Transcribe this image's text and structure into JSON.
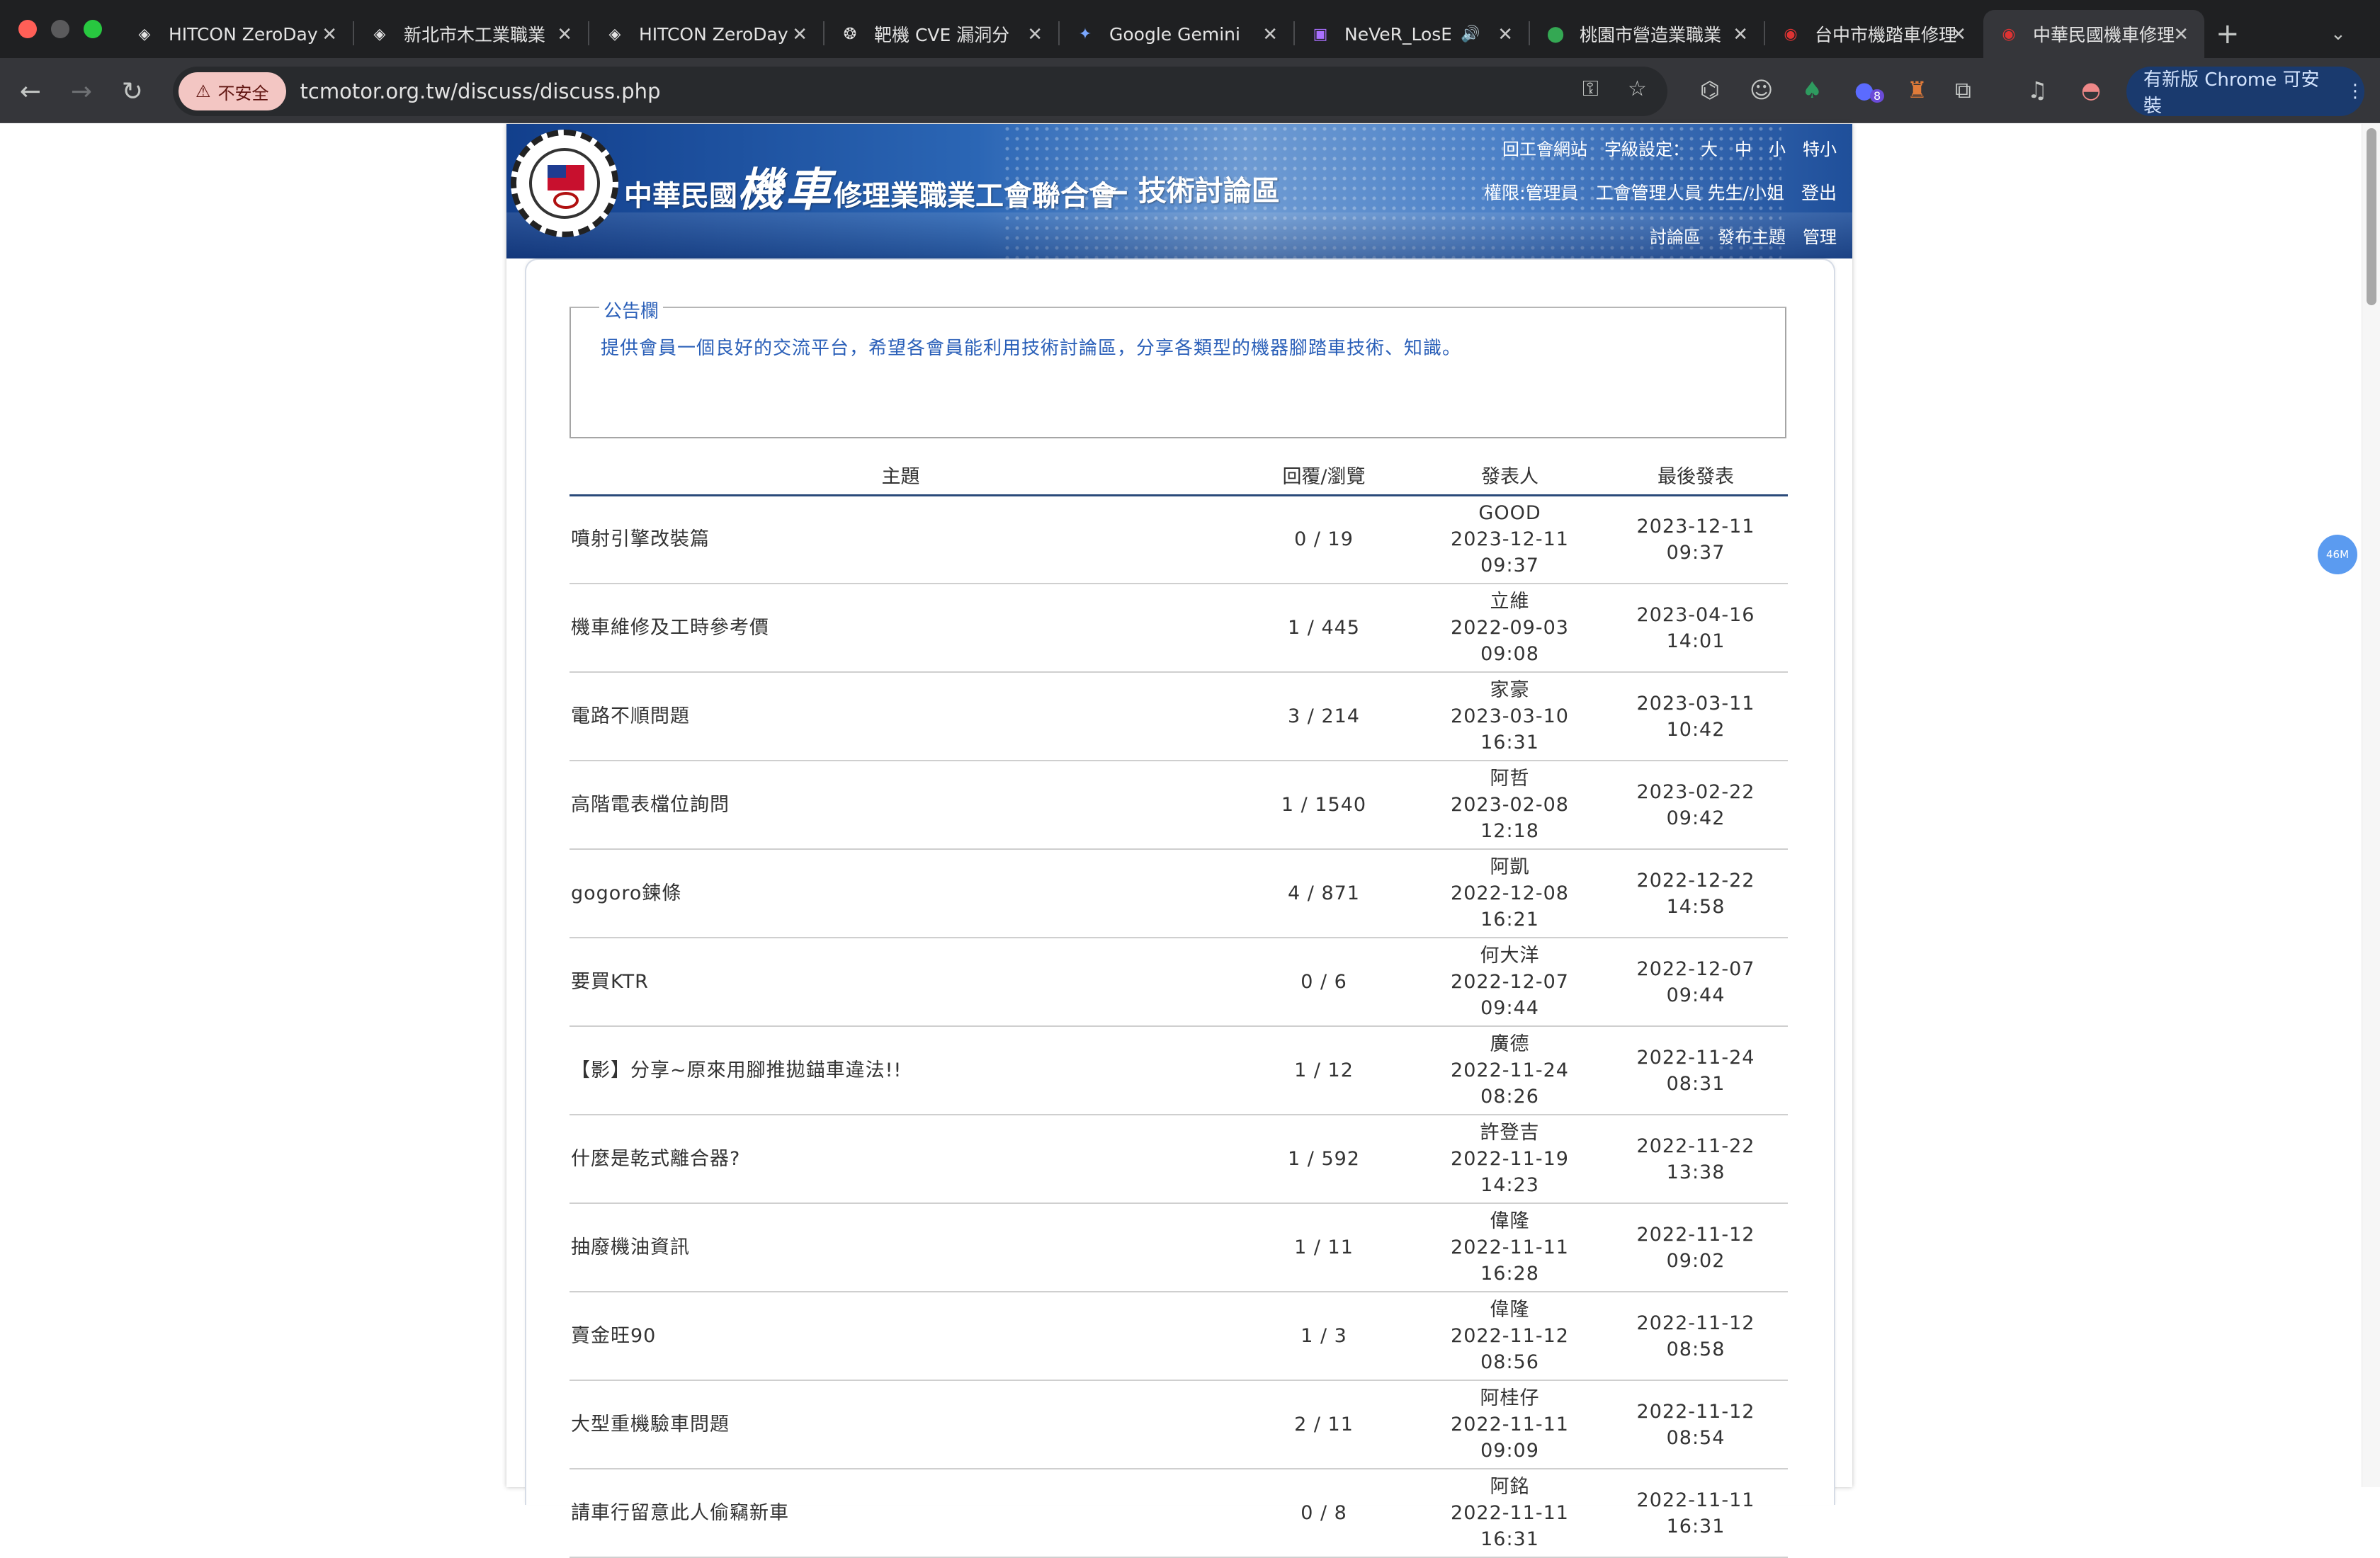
{
  "browser": {
    "tabs": [
      {
        "title": "HITCON ZeroDay",
        "icon": "hitcon-icon"
      },
      {
        "title": "新北市木工業職業",
        "icon": "hitcon-icon"
      },
      {
        "title": "HITCON ZeroDay",
        "icon": "hitcon-icon"
      },
      {
        "title": "靶機 CVE 漏洞分",
        "icon": "openai-icon"
      },
      {
        "title": "Google Gemini",
        "icon": "gemini-icon"
      },
      {
        "title": "NeVeR_LosE",
        "icon": "twitch-icon"
      },
      {
        "title": "桃園市營造業職業",
        "icon": "maps-pin-icon"
      },
      {
        "title": "台中市機踏車修理",
        "icon": "site-emblem-icon"
      },
      {
        "title": "中華民國機車修理",
        "icon": "site-emblem-icon"
      }
    ],
    "insecure_label": "不安全",
    "url": "tcmotor.org.tw/discuss/discuss.php",
    "extension_badge": "8",
    "update_label": "有新版 Chrome 可安裝",
    "floating_ball": "46M"
  },
  "site": {
    "name_prefix": "中華民國",
    "name_big": "機車",
    "name_suffix": "修理業職業工會聯合會",
    "subtitle": "— 技術討論區",
    "top_links": {
      "home": "回工會網站",
      "font_label": "字級設定：",
      "font_l": "大",
      "font_m": "中",
      "font_s": "小",
      "font_xs": "特小"
    },
    "user_links": {
      "permission": "權限:管理員",
      "user": "工會管理人員 先生/小姐",
      "logout": "登出"
    },
    "nav_links": {
      "discuss": "討論區",
      "post": "發布主題",
      "admin": "管理"
    }
  },
  "notice": {
    "title": "公告欄",
    "text": "提供會員一個良好的交流平台，希望各會員能利用技術討論區，分享各類型的機器腳踏車技術、知識。"
  },
  "table": {
    "headers": {
      "topic": "主題",
      "stats": "回覆/瀏覽",
      "poster": "發表人",
      "last": "最後發表"
    },
    "rows": [
      {
        "topic": "噴射引擎改裝篇",
        "stats": "0 / 19",
        "author": "GOOD",
        "posted": "2023-12-11 09:37",
        "last": "2023-12-11 09:37"
      },
      {
        "topic": "機車維修及工時參考價",
        "stats": "1 / 445",
        "author": "立維",
        "posted": "2022-09-03 09:08",
        "last": "2023-04-16 14:01"
      },
      {
        "topic": "電路不順問題",
        "stats": "3 / 214",
        "author": "家豪",
        "posted": "2023-03-10 16:31",
        "last": "2023-03-11 10:42"
      },
      {
        "topic": "高階電表檔位詢問",
        "stats": "1 / 1540",
        "author": "阿哲",
        "posted": "2023-02-08 12:18",
        "last": "2023-02-22 09:42"
      },
      {
        "topic": "gogoro鍊條",
        "stats": "4 / 871",
        "author": "阿凱",
        "posted": "2022-12-08 16:21",
        "last": "2022-12-22 14:58"
      },
      {
        "topic": "要買KTR",
        "stats": "0 / 6",
        "author": "何大洋",
        "posted": "2022-12-07 09:44",
        "last": "2022-12-07 09:44"
      },
      {
        "topic": "【影】分享~原來用腳推拋錨車違法!!",
        "stats": "1 / 12",
        "author": "廣德",
        "posted": "2022-11-24 08:26",
        "last": "2022-11-24 08:31"
      },
      {
        "topic": "什麼是乾式離合器?",
        "stats": "1 / 592",
        "author": "許登吉",
        "posted": "2022-11-19 14:23",
        "last": "2022-11-22 13:38"
      },
      {
        "topic": "抽廢機油資訊",
        "stats": "1 / 11",
        "author": "偉隆",
        "posted": "2022-11-11 16:28",
        "last": "2022-11-12 09:02"
      },
      {
        "topic": "賣金旺90",
        "stats": "1 / 3",
        "author": "偉隆",
        "posted": "2022-11-12 08:56",
        "last": "2022-11-12 08:58"
      },
      {
        "topic": "大型重機驗車問題",
        "stats": "2 / 11",
        "author": "阿桂仔",
        "posted": "2022-11-11 09:09",
        "last": "2022-11-12 08:54"
      },
      {
        "topic": "請車行留意此人偷竊新車",
        "stats": "0 / 8",
        "author": "阿銘",
        "posted": "2022-11-11 16:31",
        "last": "2022-11-11 16:31"
      }
    ]
  }
}
